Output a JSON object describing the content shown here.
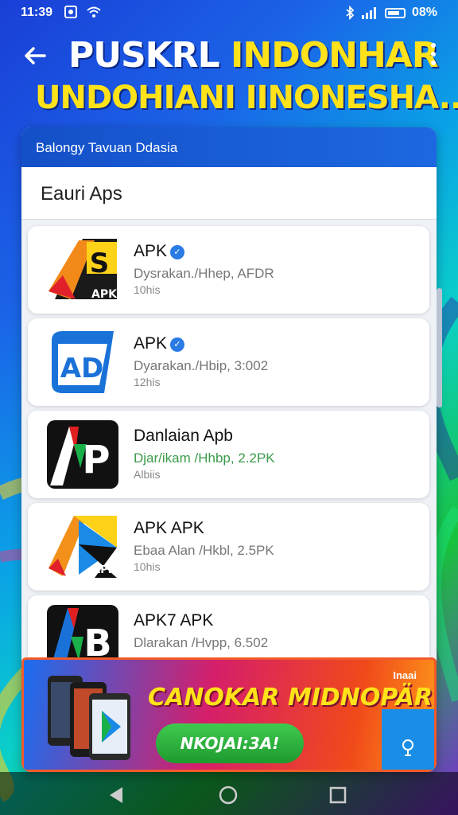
{
  "status_bar": {
    "time": "11:39",
    "battery": "08%"
  },
  "header": {
    "title_line1_white": "PUSKRL",
    "title_line1_yellow": "INDONHAR",
    "title_line2": "UNDOHIANI IINONESHA..."
  },
  "card": {
    "header_text": "Balongy Tavuan Ddasia",
    "section_title": "Eauri Aps"
  },
  "apps": [
    {
      "name": "APK",
      "verified": true,
      "desc": "Dysrakan./Hhep,  AFDR",
      "size": "10his",
      "icon": "apk-s-icon"
    },
    {
      "name": "APK",
      "verified": true,
      "desc": "Dyarakan./Hbip,  3:002",
      "size": "12his",
      "icon": "ad-shield-icon"
    },
    {
      "name": "Danlaian Apb",
      "verified": false,
      "desc": "Djar/ikam /Hhbp,  2.2PK",
      "size": "Albiis",
      "icon": "ap-black-icon"
    },
    {
      "name": "APK APK",
      "verified": false,
      "desc": "Ebaa Alan /Hkbl,  2.5PK",
      "size": "10his",
      "icon": "play-apk-icon"
    },
    {
      "name": "APK7 APK",
      "verified": false,
      "desc": "Dlarakan /Hvpp,  6.502",
      "size": "",
      "icon": "ab-color-icon"
    }
  ],
  "banner": {
    "title": "CANOKAR MIDNOPÄR",
    "cta": "NKOJAI:3A!",
    "ad_tag": "Inaai"
  },
  "colors": {
    "accent_blue": "#1a5fd6",
    "title_yellow": "#ffe21a",
    "cta_green": "#2eb23e"
  }
}
